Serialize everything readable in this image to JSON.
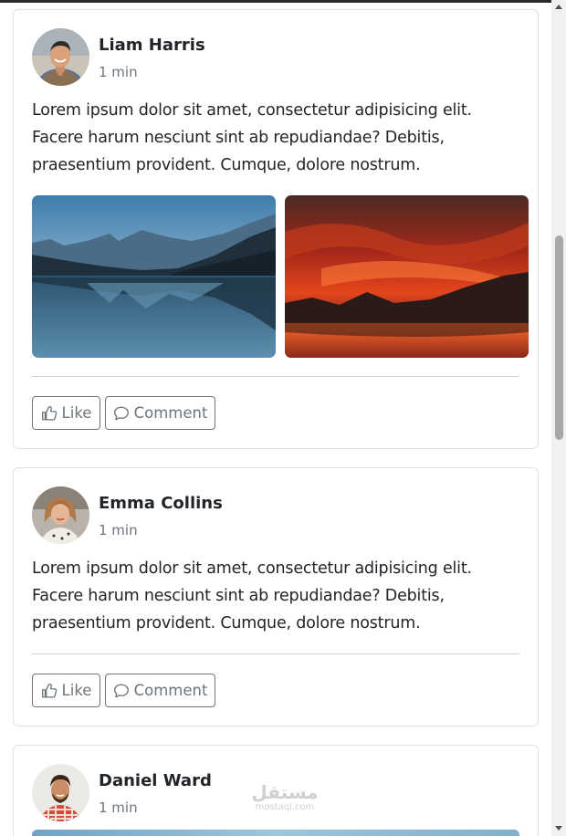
{
  "posts": [
    {
      "author": "Liam Harris",
      "time": "1 min",
      "text": "Lorem ipsum dolor sit amet, consectetur adipisicing elit. Facere harum nesciunt sint ab repudiandae? Debitis, praesentium provident. Cumque, dolore nostrum.",
      "like_label": "Like",
      "comment_label": "Comment",
      "photos": [
        "mountain-lake-photo",
        "red-sunset-photo"
      ]
    },
    {
      "author": "Emma Collins",
      "time": "1 min",
      "text": "Lorem ipsum dolor sit amet, consectetur adipisicing elit. Facere harum nesciunt sint ab repudiandae? Debitis, praesentium provident. Cumque, dolore nostrum.",
      "like_label": "Like",
      "comment_label": "Comment"
    },
    {
      "author": "Daniel Ward",
      "time": "1 min"
    }
  ],
  "watermark": {
    "arabic": "مستقل",
    "latin": "mostaql.com"
  },
  "icons": {
    "like": "thumbs-up-icon",
    "comment": "chat-bubble-icon"
  },
  "colors": {
    "border": "#dee2e6",
    "muted": "#6c757d",
    "text": "#212529"
  }
}
